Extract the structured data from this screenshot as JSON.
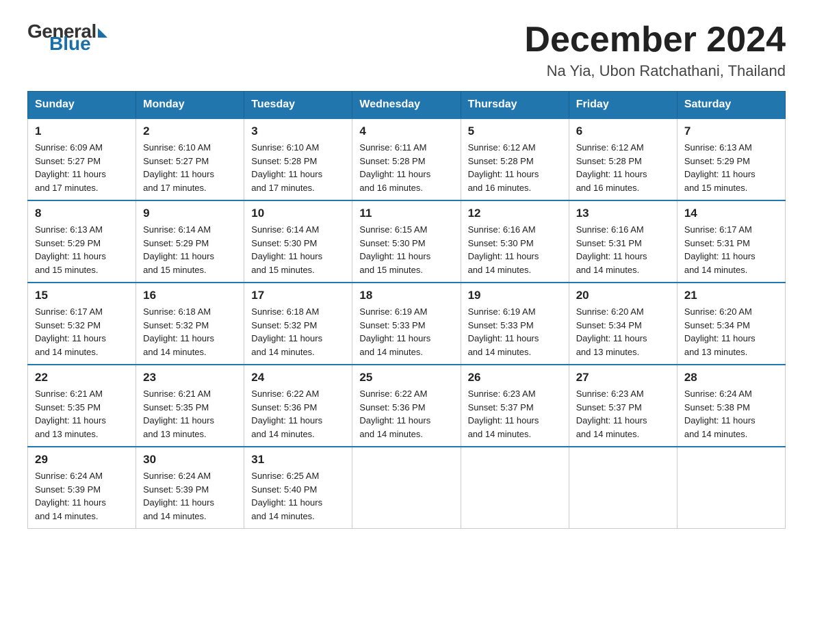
{
  "header": {
    "logo": {
      "general": "General",
      "blue": "Blue"
    },
    "title": "December 2024",
    "location": "Na Yia, Ubon Ratchathani, Thailand"
  },
  "days_of_week": [
    "Sunday",
    "Monday",
    "Tuesday",
    "Wednesday",
    "Thursday",
    "Friday",
    "Saturday"
  ],
  "weeks": [
    [
      {
        "day": "1",
        "sunrise": "6:09 AM",
        "sunset": "5:27 PM",
        "daylight": "11 hours and 17 minutes."
      },
      {
        "day": "2",
        "sunrise": "6:10 AM",
        "sunset": "5:27 PM",
        "daylight": "11 hours and 17 minutes."
      },
      {
        "day": "3",
        "sunrise": "6:10 AM",
        "sunset": "5:28 PM",
        "daylight": "11 hours and 17 minutes."
      },
      {
        "day": "4",
        "sunrise": "6:11 AM",
        "sunset": "5:28 PM",
        "daylight": "11 hours and 16 minutes."
      },
      {
        "day": "5",
        "sunrise": "6:12 AM",
        "sunset": "5:28 PM",
        "daylight": "11 hours and 16 minutes."
      },
      {
        "day": "6",
        "sunrise": "6:12 AM",
        "sunset": "5:28 PM",
        "daylight": "11 hours and 16 minutes."
      },
      {
        "day": "7",
        "sunrise": "6:13 AM",
        "sunset": "5:29 PM",
        "daylight": "11 hours and 15 minutes."
      }
    ],
    [
      {
        "day": "8",
        "sunrise": "6:13 AM",
        "sunset": "5:29 PM",
        "daylight": "11 hours and 15 minutes."
      },
      {
        "day": "9",
        "sunrise": "6:14 AM",
        "sunset": "5:29 PM",
        "daylight": "11 hours and 15 minutes."
      },
      {
        "day": "10",
        "sunrise": "6:14 AM",
        "sunset": "5:30 PM",
        "daylight": "11 hours and 15 minutes."
      },
      {
        "day": "11",
        "sunrise": "6:15 AM",
        "sunset": "5:30 PM",
        "daylight": "11 hours and 15 minutes."
      },
      {
        "day": "12",
        "sunrise": "6:16 AM",
        "sunset": "5:30 PM",
        "daylight": "11 hours and 14 minutes."
      },
      {
        "day": "13",
        "sunrise": "6:16 AM",
        "sunset": "5:31 PM",
        "daylight": "11 hours and 14 minutes."
      },
      {
        "day": "14",
        "sunrise": "6:17 AM",
        "sunset": "5:31 PM",
        "daylight": "11 hours and 14 minutes."
      }
    ],
    [
      {
        "day": "15",
        "sunrise": "6:17 AM",
        "sunset": "5:32 PM",
        "daylight": "11 hours and 14 minutes."
      },
      {
        "day": "16",
        "sunrise": "6:18 AM",
        "sunset": "5:32 PM",
        "daylight": "11 hours and 14 minutes."
      },
      {
        "day": "17",
        "sunrise": "6:18 AM",
        "sunset": "5:32 PM",
        "daylight": "11 hours and 14 minutes."
      },
      {
        "day": "18",
        "sunrise": "6:19 AM",
        "sunset": "5:33 PM",
        "daylight": "11 hours and 14 minutes."
      },
      {
        "day": "19",
        "sunrise": "6:19 AM",
        "sunset": "5:33 PM",
        "daylight": "11 hours and 14 minutes."
      },
      {
        "day": "20",
        "sunrise": "6:20 AM",
        "sunset": "5:34 PM",
        "daylight": "11 hours and 13 minutes."
      },
      {
        "day": "21",
        "sunrise": "6:20 AM",
        "sunset": "5:34 PM",
        "daylight": "11 hours and 13 minutes."
      }
    ],
    [
      {
        "day": "22",
        "sunrise": "6:21 AM",
        "sunset": "5:35 PM",
        "daylight": "11 hours and 13 minutes."
      },
      {
        "day": "23",
        "sunrise": "6:21 AM",
        "sunset": "5:35 PM",
        "daylight": "11 hours and 13 minutes."
      },
      {
        "day": "24",
        "sunrise": "6:22 AM",
        "sunset": "5:36 PM",
        "daylight": "11 hours and 14 minutes."
      },
      {
        "day": "25",
        "sunrise": "6:22 AM",
        "sunset": "5:36 PM",
        "daylight": "11 hours and 14 minutes."
      },
      {
        "day": "26",
        "sunrise": "6:23 AM",
        "sunset": "5:37 PM",
        "daylight": "11 hours and 14 minutes."
      },
      {
        "day": "27",
        "sunrise": "6:23 AM",
        "sunset": "5:37 PM",
        "daylight": "11 hours and 14 minutes."
      },
      {
        "day": "28",
        "sunrise": "6:24 AM",
        "sunset": "5:38 PM",
        "daylight": "11 hours and 14 minutes."
      }
    ],
    [
      {
        "day": "29",
        "sunrise": "6:24 AM",
        "sunset": "5:39 PM",
        "daylight": "11 hours and 14 minutes."
      },
      {
        "day": "30",
        "sunrise": "6:24 AM",
        "sunset": "5:39 PM",
        "daylight": "11 hours and 14 minutes."
      },
      {
        "day": "31",
        "sunrise": "6:25 AM",
        "sunset": "5:40 PM",
        "daylight": "11 hours and 14 minutes."
      },
      null,
      null,
      null,
      null
    ]
  ],
  "labels": {
    "sunrise": "Sunrise:",
    "sunset": "Sunset:",
    "daylight": "Daylight:"
  }
}
